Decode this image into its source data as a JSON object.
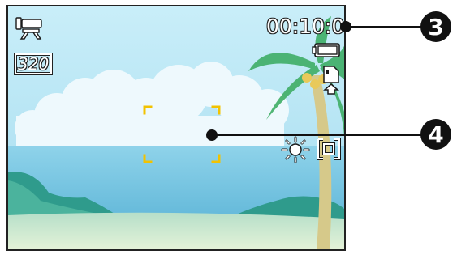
{
  "screen": {
    "mode_icon": "video-camera-icon",
    "resolution_label": "320",
    "recording_time": "00:10:00",
    "battery_icon": "battery-full-icon",
    "storage_icon": "internal-memory-icon",
    "white_balance_icon": "daylight-sun-icon",
    "stabilizer_icon": "anti-shake-frame-icon",
    "focus_frame_icon": "focus-frame-icon"
  },
  "callouts": [
    {
      "number": "3"
    },
    {
      "number": "4"
    }
  ],
  "colors": {
    "osd_text": "#ffffff",
    "osd_outline": "#1a1a1a",
    "focus_bracket": "#f2c200",
    "sky": "#aee4f5",
    "sea": "#74c7e2",
    "callout": "#111111"
  }
}
